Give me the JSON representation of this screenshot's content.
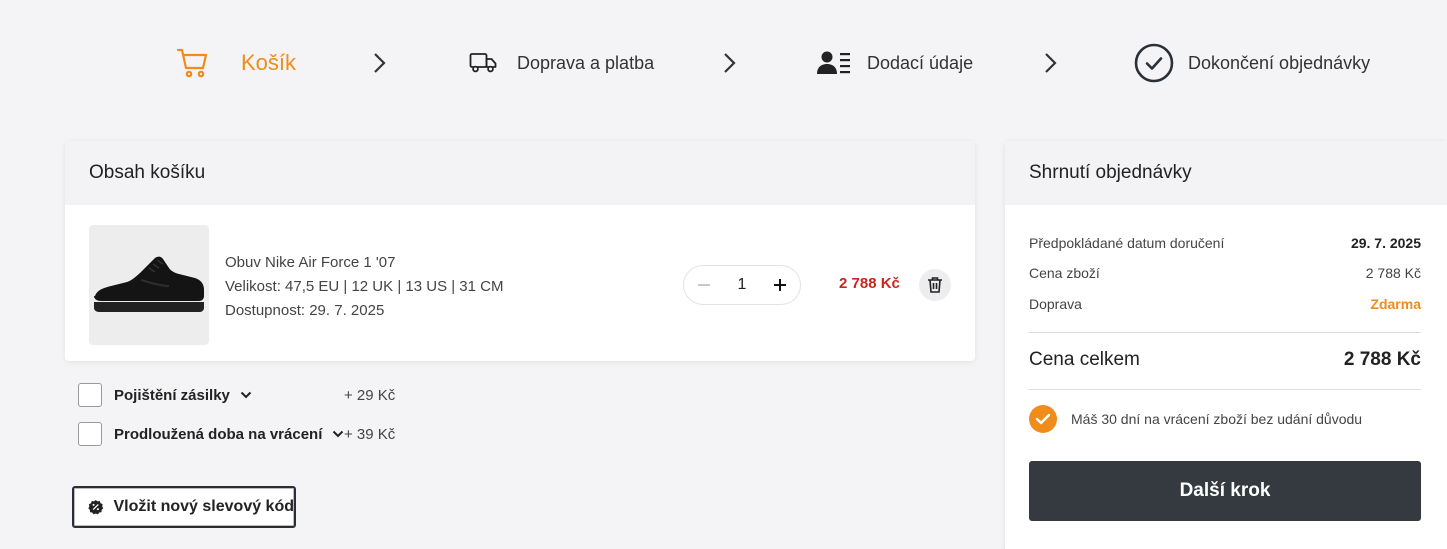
{
  "steps": [
    {
      "label": "Košík",
      "icon": "cart-icon",
      "active": true
    },
    {
      "label": "Doprava a platba",
      "icon": "truck-icon",
      "active": false
    },
    {
      "label": "Dodací údaje",
      "icon": "user-list-icon",
      "active": false
    },
    {
      "label": "Dokončení objednávky",
      "icon": "check-circle-icon",
      "active": false
    }
  ],
  "cart": {
    "title": "Obsah košíku",
    "item": {
      "name": "Obuv Nike Air Force 1 '07",
      "size": "Velikost: 47,5 EU | 12 UK | 13 US | 31 CM",
      "availability": "Dostupnost:  29. 7. 2025",
      "quantity": "1",
      "price": "2 788 Kč"
    }
  },
  "options": [
    {
      "label": "Pojištění zásilky",
      "price": "+ 29 Kč"
    },
    {
      "label": "Prodloužená doba na vrácení",
      "price": "+ 39 Kč"
    }
  ],
  "coupon": {
    "label": "Vložit nový slevový kód"
  },
  "summary": {
    "title": "Shrnutí objednávky",
    "delivery_label": "Předpokládané datum doručení",
    "delivery_value": "29. 7. 2025",
    "goods_label": "Cena zboží",
    "goods_value": "2 788 Kč",
    "shipping_label": "Doprava",
    "shipping_value": "Zdarma",
    "total_label": "Cena celkem",
    "total_value": "2 788 Kč",
    "return_note": "Máš 30 dní na vrácení zboží bez udání důvodu",
    "next_label": "Další krok"
  },
  "colors": {
    "accent": "#f08c1a",
    "price_red": "#c8271d",
    "dark_button": "#353a40"
  }
}
